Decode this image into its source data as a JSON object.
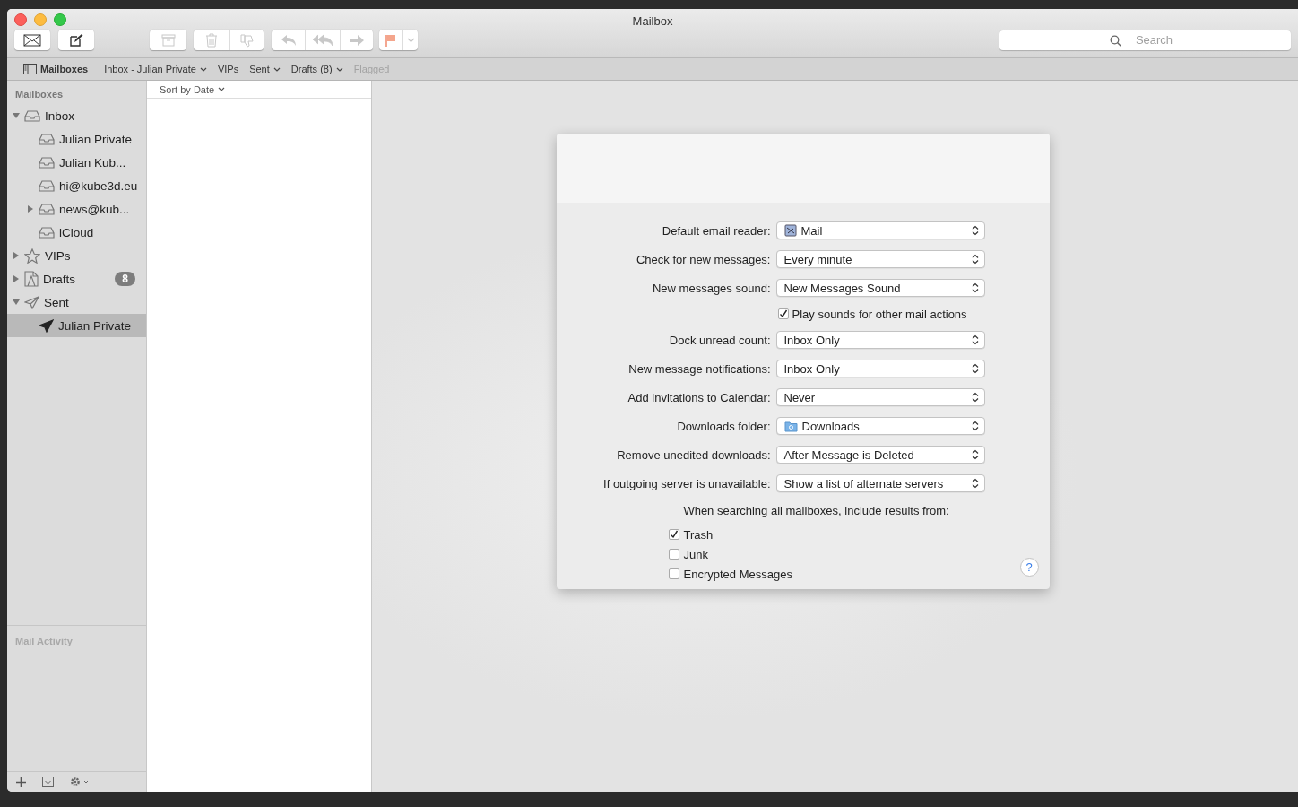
{
  "window": {
    "title": "Mailbox"
  },
  "toolbar": {
    "groups": [
      {
        "buttons": [
          {
            "kind": "mail",
            "disabled": false
          }
        ]
      },
      {
        "buttons": [
          {
            "kind": "compose",
            "disabled": false
          }
        ]
      },
      {
        "buttons": [
          {
            "kind": "archive",
            "disabled": true
          }
        ]
      },
      {
        "buttons": [
          {
            "kind": "trash",
            "disabled": true
          },
          {
            "kind": "junk",
            "disabled": true
          }
        ]
      },
      {
        "buttons": [
          {
            "kind": "reply",
            "disabled": true
          },
          {
            "kind": "reply-all",
            "disabled": true
          },
          {
            "kind": "forward",
            "disabled": true
          }
        ]
      },
      {
        "buttons": [
          {
            "kind": "flag",
            "disabled": true
          },
          {
            "kind": "menu",
            "disabled": true
          }
        ]
      }
    ],
    "search": {
      "placeholder": "Search"
    }
  },
  "favorites_bar": [
    {
      "label": "Mailboxes",
      "kind": "toggle",
      "disabled": false
    },
    {
      "label": "Inbox - Julian Private",
      "kind": "menu",
      "disabled": false
    },
    {
      "label": "VIPs",
      "kind": "plain",
      "disabled": false
    },
    {
      "label": "Sent",
      "kind": "menu",
      "disabled": false
    },
    {
      "label": "Drafts (8)",
      "kind": "menu",
      "disabled": false
    },
    {
      "label": "Flagged",
      "kind": "plain",
      "disabled": true
    }
  ],
  "sidebar": {
    "heading": "Mailboxes",
    "items": [
      {
        "label": "Inbox",
        "kind": "inbox",
        "expanded": true,
        "selected": false,
        "children": [
          {
            "label": "Julian Private",
            "kind": "inbox",
            "selected": false
          },
          {
            "label": "Julian Kub...",
            "kind": "inbox",
            "selected": false
          },
          {
            "label": "hi@kube3d.eu",
            "kind": "inbox",
            "selected": false
          },
          {
            "label": "news@kub...",
            "kind": "inbox",
            "expanded": false,
            "selected": false
          },
          {
            "label": "iCloud",
            "kind": "inbox",
            "selected": false
          }
        ]
      },
      {
        "label": "VIPs",
        "kind": "vips",
        "expanded": false,
        "selected": false
      },
      {
        "label": "Drafts",
        "kind": "drafts",
        "expanded": false,
        "selected": false,
        "badge": "8"
      },
      {
        "label": "Sent",
        "kind": "sent",
        "expanded": true,
        "selected": false,
        "children": [
          {
            "label": "Julian Private",
            "kind": "sent",
            "selected": true
          }
        ]
      }
    ],
    "activity_heading": "Mail Activity"
  },
  "message_list": {
    "sort": "Sort by Date"
  },
  "preferences": {
    "rows": [
      {
        "kind": "app-popup",
        "label": "Default email reader:",
        "value": "Mail"
      },
      {
        "kind": "popup",
        "label": "Check for new messages:",
        "value": "Every minute"
      },
      {
        "kind": "popup",
        "label": "New messages sound:",
        "value": "New Messages Sound"
      },
      {
        "kind": "checkbox",
        "label": "Play sounds for other mail actions",
        "checked": true
      },
      {
        "kind": "popup",
        "label": "Dock unread count:",
        "value": "Inbox Only"
      },
      {
        "kind": "popup",
        "label": "New message notifications:",
        "value": "Inbox Only"
      },
      {
        "kind": "popup",
        "label": "Add invitations to Calendar:",
        "value": "Never"
      },
      {
        "kind": "folder-popup",
        "label": "Downloads folder:",
        "value": "Downloads"
      },
      {
        "kind": "popup",
        "label": "Remove unedited downloads:",
        "value": "After Message is Deleted"
      },
      {
        "kind": "popup",
        "label": "If outgoing server is unavailable:",
        "value": "Show a list of alternate servers"
      },
      {
        "kind": "heading",
        "label": "When searching all mailboxes, include results from:"
      },
      {
        "kind": "option",
        "label": "Trash",
        "checked": true
      },
      {
        "kind": "option",
        "label": "Junk",
        "checked": false
      },
      {
        "kind": "option",
        "label": "Encrypted Messages",
        "checked": false
      }
    ],
    "help": "?"
  }
}
